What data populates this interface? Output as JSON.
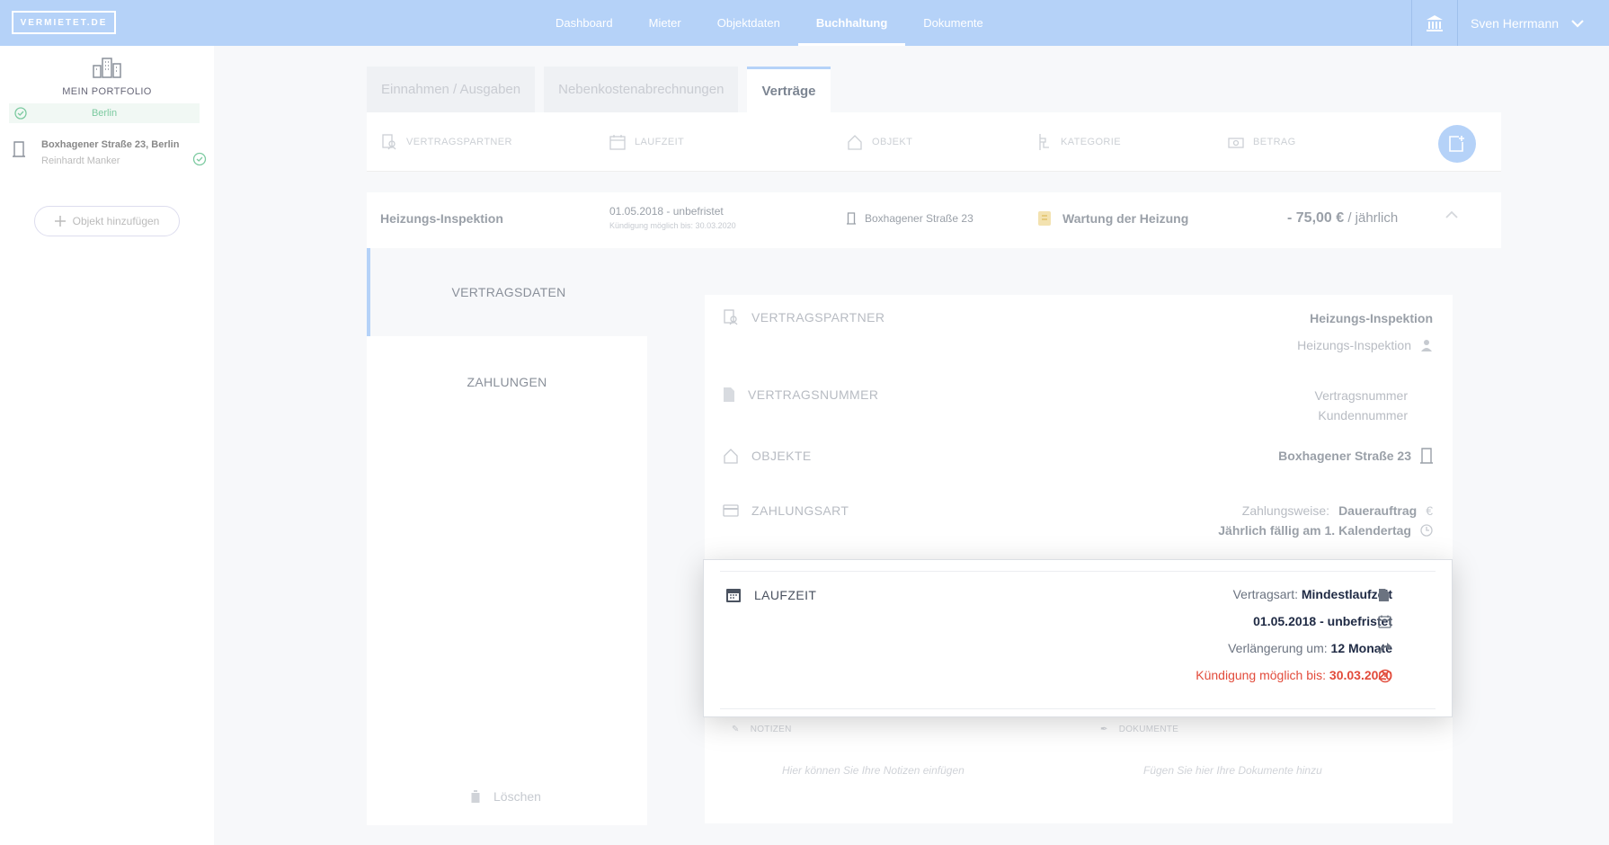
{
  "header": {
    "logo": "VERMIETET.DE",
    "nav": [
      "Dashboard",
      "Mieter",
      "Objektdaten",
      "Buchhaltung",
      "Dokumente"
    ],
    "active_nav": "Buchhaltung",
    "user_name": "Sven Herrmann"
  },
  "sidebar": {
    "portfolio_label": "MEIN PORTFOLIO",
    "city": "Berlin",
    "property_address": "Boxhagener Straße 23, Berlin",
    "property_owner": "Reinhardt Manker",
    "add_object": "Objekt hinzufügen"
  },
  "tabs": [
    "Einnahmen / Ausgaben",
    "Nebenkostenabrechnungen",
    "Verträge"
  ],
  "columns": [
    "VERTRAGSPARTNER",
    "LAUFZEIT",
    "OBJEKT",
    "KATEGORIE",
    "BETRAG"
  ],
  "contract": {
    "name": "Heizungs-Inspektion",
    "dates": "01.05.2018 - unbefristet",
    "notice": "Kündigung möglich bis: 30.03.2020",
    "object": "Boxhagener Straße 23",
    "category": "Wartung der Heizung",
    "amount": "- 75,00 €",
    "interval": "/ jährlich"
  },
  "detail_nav": {
    "vertragsdaten": "VERTRAGSDATEN",
    "zahlungen": "ZAHLUNGEN",
    "delete": "Löschen"
  },
  "details": {
    "partner_label": "VERTRAGSPARTNER",
    "partner_name": "Heizungs-Inspektion",
    "partner_sub": "Heizungs-Inspektion",
    "number_label": "VERTRAGSNUMMER",
    "number_line1": "Vertragsnummer",
    "number_line2": "Kundennummer",
    "objects_label": "OBJEKTE",
    "objects_value": "Boxhagener Straße 23",
    "payment_label": "ZAHLUNGSART",
    "payment_prefix": "Zahlungsweise:",
    "payment_value": "Dauerauftrag",
    "payment_due": "Jährlich fällig am 1. Kalendertag",
    "notes_label": "NOTIZEN",
    "docs_label": "DOKUMENTE",
    "notes_placeholder": "Hier können Sie Ihre Notizen einfügen",
    "docs_placeholder": "Fügen Sie hier Ihre Dokumente hinzu"
  },
  "laufzeit": {
    "label": "LAUFZEIT",
    "type_prefix": "Vertragsart:",
    "type_value": "Mindestlaufzeit",
    "period": "01.05.2018 - unbefristet",
    "ext_prefix": "Verlängerung um:",
    "ext_value": "12 Monate",
    "cancel_prefix": "Kündigung möglich bis:",
    "cancel_value": "30.03.2020"
  },
  "colors": {
    "brand": "#b5d2f8",
    "warning": "#e24b3b",
    "success": "#7ccaa0"
  }
}
